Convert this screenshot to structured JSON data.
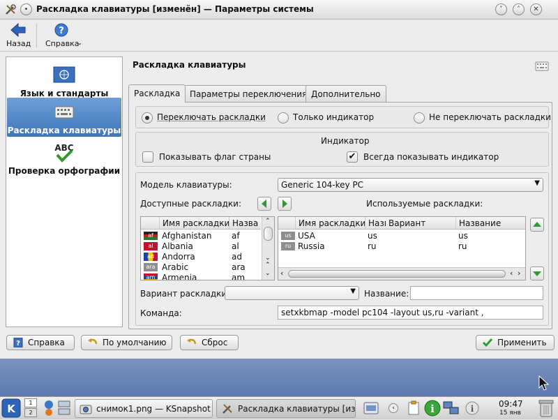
{
  "window": {
    "title": "Раскладка клавиатуры [изменён] — Параметры системы"
  },
  "toolbar": {
    "back_label": "Назад",
    "help_label": "Справка"
  },
  "sidebar": {
    "items": [
      {
        "label": "Язык и стандарты",
        "icon": "flag-un-icon"
      },
      {
        "label": "Раскладка клавиатуры",
        "icon": "keyboard-icon"
      },
      {
        "label": "Проверка орфографии",
        "icon": "abc-check-icon"
      }
    ]
  },
  "page": {
    "heading": "Раскладка клавиатуры"
  },
  "tabs": [
    {
      "label": "Раскладка"
    },
    {
      "label": "Параметры переключения"
    },
    {
      "label": "Дополнительно"
    }
  ],
  "mode": {
    "options": [
      "Переключать раскладки",
      "Только индикатор",
      "Не переключать раскладки"
    ],
    "selected": "Переключать раскладки"
  },
  "indicator": {
    "title": "Индикатор",
    "show_flag_label": "Показывать флаг страны",
    "always_show_label": "Всегда показывать индикатор",
    "show_flag": false,
    "always_show": true
  },
  "model": {
    "label": "Модель клавиатуры:",
    "value": "Generic 104-key PC"
  },
  "available": {
    "label": "Доступные раскладки:",
    "headers": [
      "Имя раскладки",
      "Назва"
    ],
    "rows": [
      {
        "flag": "af",
        "name": "Afghanistan",
        "code": "af"
      },
      {
        "flag": "al",
        "name": "Albania",
        "code": "al"
      },
      {
        "flag": "ad",
        "name": "Andorra",
        "code": "ad"
      },
      {
        "flag": "ara",
        "name": "Arabic",
        "code": "ara"
      },
      {
        "flag": "am",
        "name": "Armenia",
        "code": "am"
      }
    ]
  },
  "used": {
    "label": "Используемые раскладки:",
    "headers": [
      "Имя раскладки",
      "Назв",
      "Вариант",
      "Название"
    ],
    "rows": [
      {
        "flag": "us",
        "name": "USA",
        "code": "us",
        "variant": "",
        "title": "us"
      },
      {
        "flag": "ru",
        "name": "Russia",
        "code": "ru",
        "variant": "",
        "title": "ru"
      }
    ]
  },
  "variant": {
    "label": "Вариант раскладки:",
    "value": ""
  },
  "name_field": {
    "label": "Название:",
    "value": ""
  },
  "command": {
    "label": "Команда:",
    "value": "setxkbmap -model pc104 -layout us,ru -variant ,"
  },
  "buttons": {
    "help": "Справка",
    "defaults": "По умолчанию",
    "reset": "Сброс",
    "apply": "Применить"
  },
  "taskbar": {
    "tasks": [
      "снимок1.png — KSnapshot",
      "Раскладка клавиатуры [изме"
    ],
    "clock_time": "09:47",
    "clock_date": "15 янв",
    "pager": [
      "1",
      "2"
    ]
  }
}
